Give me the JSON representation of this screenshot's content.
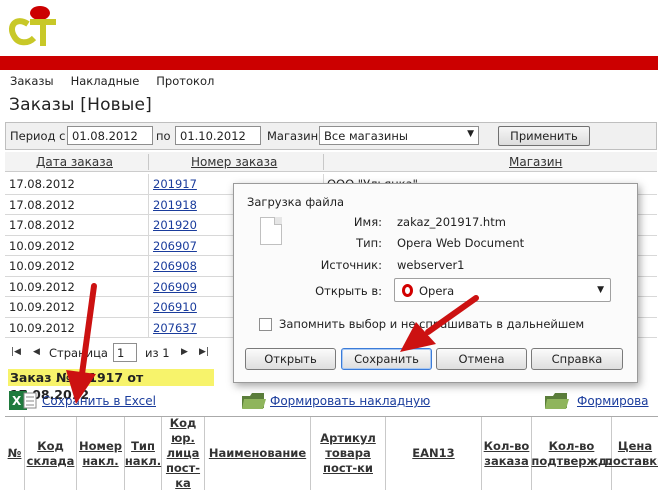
{
  "app": {
    "logo_text": "CT"
  },
  "menu": [
    "Заказы",
    "Накладные",
    "Протокол"
  ],
  "page_title": "Заказы [Новые]",
  "filter": {
    "period_label": "Период с",
    "date_from": "01.08.2012",
    "to_label": "по",
    "date_to": "01.10.2012",
    "store_label": "Магазин",
    "store_value": "Все магазины",
    "apply_label": "Применить"
  },
  "orders_table": {
    "columns": [
      "Дата заказа",
      "Номер заказа",
      "Магазин"
    ],
    "rows": [
      {
        "date": "17.08.2012",
        "number": "201917",
        "store": "ООО \"Ульянка\""
      },
      {
        "date": "17.08.2012",
        "number": "201918",
        "store": ""
      },
      {
        "date": "17.08.2012",
        "number": "201920",
        "store": ""
      },
      {
        "date": "10.09.2012",
        "number": "206907",
        "store": ""
      },
      {
        "date": "10.09.2012",
        "number": "206908",
        "store": ""
      },
      {
        "date": "10.09.2012",
        "number": "206909",
        "store": ""
      },
      {
        "date": "10.09.2012",
        "number": "206910",
        "store": ""
      },
      {
        "date": "10.09.2012",
        "number": "207637",
        "store": ""
      }
    ]
  },
  "pager": {
    "page_label": "Страница",
    "page_value": "1",
    "of_label": "из 1"
  },
  "order_title": "Заказ №201917 от 17.08.2012",
  "actions": {
    "excel": "Сохранить в Excel",
    "invoice": "Формировать накладную",
    "invoice2": "Формирова"
  },
  "detail_columns": [
    "№",
    "Код склада",
    "Номер накл.",
    "Тип накл.",
    "Код юр. лица пост-ка",
    "Наименование",
    "Артикул товара пост-ки",
    "EAN13",
    "Кол-во заказа",
    "Кол-во подтвержд.",
    "Цена поставки"
  ],
  "dialog": {
    "title": "Загрузка файла",
    "name_label": "Имя:",
    "name_value": "zakaz_201917.htm",
    "type_label": "Тип:",
    "type_value": "Opera Web Document",
    "source_label": "Источник:",
    "source_value": "webserver1",
    "open_with_label": "Открыть в:",
    "open_with_value": "Opera",
    "remember_label": "Запомнить выбор и не спрашивать в дальнейшем",
    "remember_checked": false,
    "buttons": {
      "open": "Открыть",
      "save": "Сохранить",
      "cancel": "Отмена",
      "help": "Справка"
    }
  },
  "colors": {
    "brand_red": "#cc0000",
    "logo_yellow": "#c8c828",
    "highlight_yellow": "#f7f36b",
    "link_blue": "#1a3c9c"
  }
}
